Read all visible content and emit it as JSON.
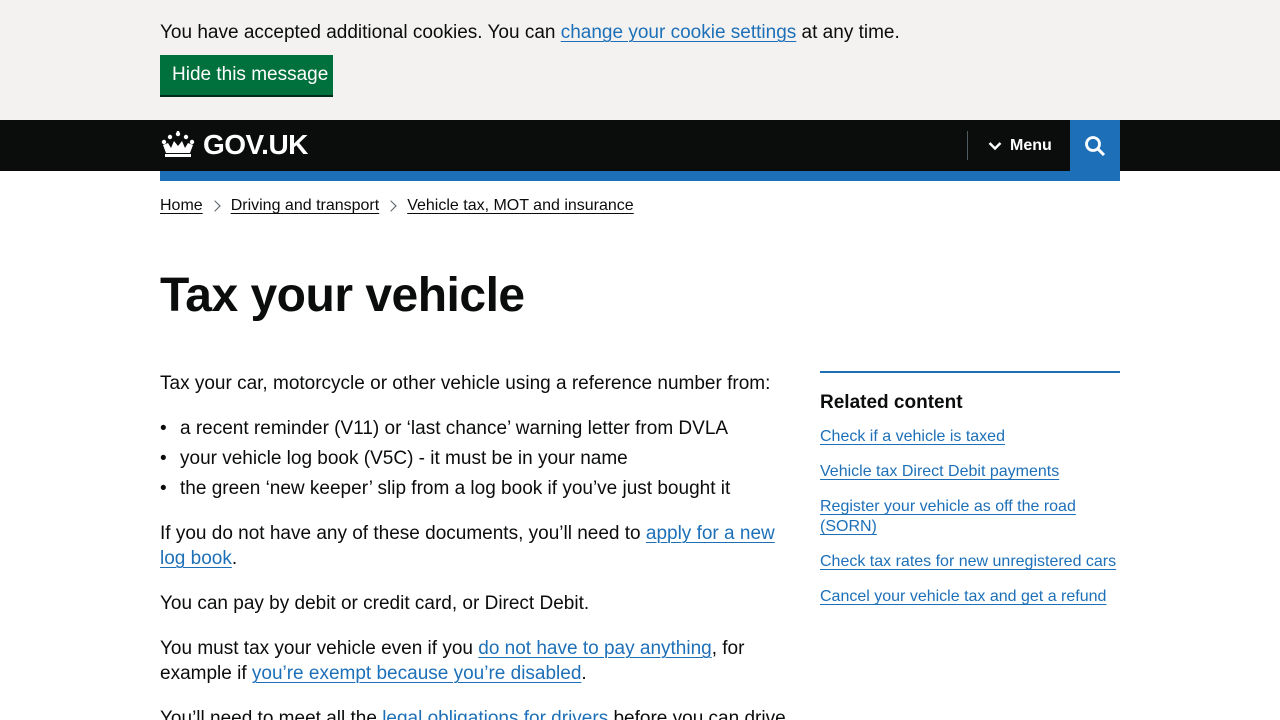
{
  "cookie_banner": {
    "text_before": "You have accepted additional cookies. You can ",
    "link": "change your cookie settings",
    "text_after": " at any time.",
    "hide_button": "Hide this message"
  },
  "header": {
    "logo_text": "GOV.UK",
    "menu_label": "Menu"
  },
  "breadcrumb": [
    "Home",
    "Driving and transport",
    "Vehicle tax, MOT and insurance"
  ],
  "title": "Tax your vehicle",
  "body": {
    "intro": "Tax your car, motorcycle or other vehicle using a reference number from:",
    "bullets": [
      "a recent reminder (V11) or ‘last chance’ warning letter from DVLA",
      "your vehicle log book (V5C) - it must be in your name",
      "the green ‘new keeper’ slip from a log book if you’ve just bought it"
    ],
    "no_docs_before": "If you do not have any of these documents, you’ll need to ",
    "no_docs_link": "apply for a new log book",
    "no_docs_after": ".",
    "pay": "You can pay by debit or credit card, or Direct Debit.",
    "must_before": "You must tax your vehicle even if you ",
    "must_link1": "do not have to pay anything",
    "must_mid": ", for example if ",
    "must_link2": "you’re exempt because you’re disabled",
    "must_after": ".",
    "need_before": "You’ll need to meet all the ",
    "need_link": "legal obligations for drivers",
    "need_after": " before you can drive."
  },
  "related": {
    "heading": "Related content",
    "links": [
      "Check if a vehicle is taxed",
      "Vehicle tax Direct Debit payments",
      "Register your vehicle as off the road (SORN)",
      "Check tax rates for new unregistered cars",
      "Cancel your vehicle tax and get a refund"
    ]
  },
  "colors": {
    "link": "#1d70b8",
    "header_bg": "#0b0c0c",
    "cookie_bg": "#f3f2f1",
    "button_green": "#00703c"
  }
}
